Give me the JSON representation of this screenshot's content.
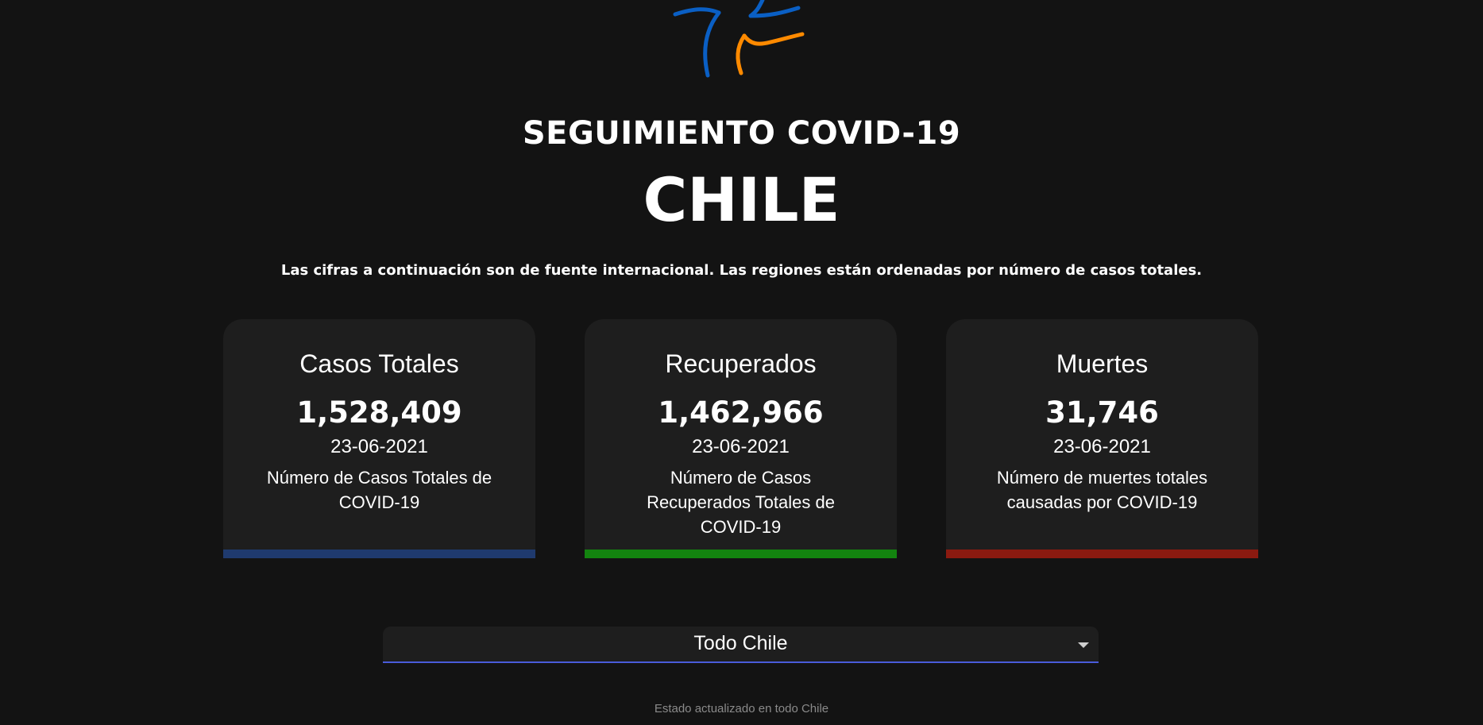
{
  "header": {
    "title": "SEGUIMIENTO COVID-19",
    "country": "CHILE",
    "subtitle": "Las cifras a continuación son de fuente internacional. Las regiones están ordenadas por número de casos totales."
  },
  "cards": [
    {
      "title": "Casos Totales",
      "value": "1,528,409",
      "date": "23-06-2021",
      "description": "Número de Casos Totales de COVID-19",
      "accent": "#1f3a6e"
    },
    {
      "title": "Recuperados",
      "value": "1,462,966",
      "date": "23-06-2021",
      "description": "Número de Casos Recuperados Totales de COVID-19",
      "accent": "#13840f"
    },
    {
      "title": "Muertes",
      "value": "31,746",
      "date": "23-06-2021",
      "description": "Número de muertes totales causadas por COVID-19",
      "accent": "#8b1a10"
    }
  ],
  "region_select": {
    "selected": "Todo Chile",
    "underline_color": "#4a5cdb"
  },
  "status": {
    "text": "Estado actualizado en todo Chile"
  },
  "logo": {
    "icon": "covid-tracker-logo",
    "colors": [
      "#0a5fc4",
      "#ff8a00"
    ]
  }
}
